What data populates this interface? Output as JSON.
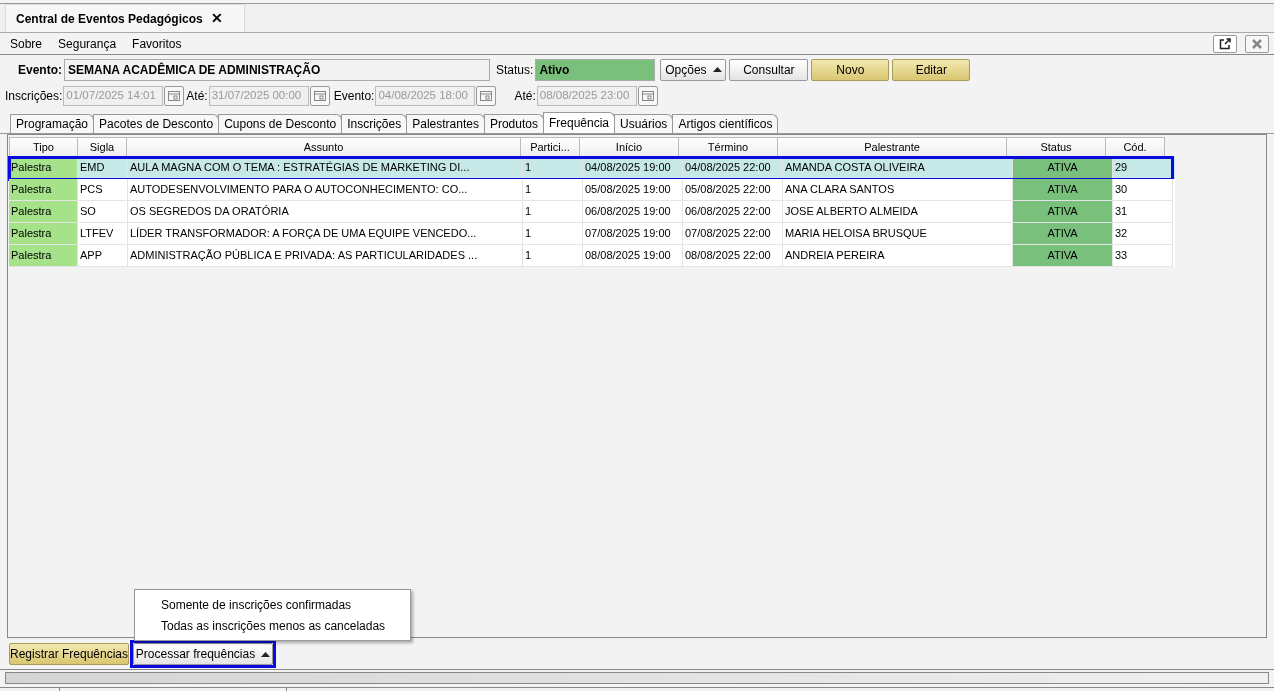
{
  "window_tab": {
    "title": "Central de Eventos Pedagógicos",
    "close": "✕"
  },
  "menu": [
    "Sobre",
    "Segurança",
    "Favoritos"
  ],
  "evento": {
    "label": "Evento:",
    "value": "SEMANA ACADÊMICA DE ADMINISTRAÇÃO"
  },
  "status": {
    "label": "Status:",
    "value": "Ativo"
  },
  "buttons": [
    {
      "label": "Opções",
      "kind": "dropdown"
    },
    {
      "label": "Consultar",
      "kind": "plain"
    },
    {
      "label": "Novo",
      "kind": "primary"
    },
    {
      "label": "Editar",
      "kind": "primary"
    }
  ],
  "dates": [
    {
      "label": "Inscrições:",
      "value": "01/07/2025 14:01",
      "disabled": true
    },
    {
      "label": "Até:",
      "value": "31/07/2025 00:00",
      "disabled": true
    },
    {
      "label": "Evento:",
      "value": "04/08/2025 18:00",
      "disabled": true
    },
    {
      "label": "Até:",
      "value": "08/08/2025 23:00",
      "disabled": true
    }
  ],
  "tabs": [
    {
      "label": "Programação",
      "selected": false
    },
    {
      "label": "Pacotes de Desconto",
      "selected": false
    },
    {
      "label": "Cupons de Desconto",
      "selected": false
    },
    {
      "label": "Inscrições",
      "selected": false
    },
    {
      "label": "Palestrantes",
      "selected": false
    },
    {
      "label": "Produtos",
      "selected": false
    },
    {
      "label": "Frequência",
      "selected": true
    },
    {
      "label": "Usuários",
      "selected": false
    },
    {
      "label": "Artigos científicos",
      "selected": false
    }
  ],
  "table": {
    "columns": [
      "Tipo",
      "Sigla",
      "Assunto",
      "Partici...",
      "Início",
      "Término",
      "Palestrante",
      "Status",
      "Cód."
    ],
    "rows": [
      {
        "selected": true,
        "highlighted": true,
        "cells": [
          "Palestra",
          "EMD",
          "AULA MAGNA COM O TEMA : ESTRATÉGIAS DE MARKETING DI...",
          "1",
          "04/08/2025 19:00",
          "04/08/2025 22:00",
          "AMANDA COSTA OLIVEIRA",
          "ATIVA",
          "29"
        ]
      },
      {
        "selected": false,
        "highlighted": false,
        "cells": [
          "Palestra",
          "PCS",
          "AUTODESENVOLVIMENTO PARA O AUTOCONHECIMENTO: CO...",
          "1",
          "05/08/2025 19:00",
          "05/08/2025 22:00",
          "ANA CLARA SANTOS",
          "ATIVA",
          "30"
        ]
      },
      {
        "selected": false,
        "highlighted": false,
        "cells": [
          "Palestra",
          "SO",
          "OS SEGREDOS DA ORATÓRIA",
          "1",
          "06/08/2025 19:00",
          "06/08/2025 22:00",
          "JOSE ALBERTO ALMEIDA",
          "ATIVA",
          "31"
        ]
      },
      {
        "selected": false,
        "highlighted": false,
        "cells": [
          "Palestra",
          "LTFEV",
          "LÍDER TRANSFORMADOR: A FORÇA DE UMA EQUIPE VENCEDO...",
          "1",
          "07/08/2025 19:00",
          "07/08/2025 22:00",
          "MARIA HELOISA BRUSQUE",
          "ATIVA",
          "32"
        ]
      },
      {
        "selected": false,
        "highlighted": false,
        "cells": [
          "Palestra",
          "APP",
          "ADMINISTRAÇÃO PÚBLICA E PRIVADA: AS PARTICULARIDADES ...",
          "1",
          "08/08/2025 19:00",
          "08/08/2025 22:00",
          "ANDREIA PEREIRA",
          "ATIVA",
          "33"
        ]
      }
    ]
  },
  "popup_menu": [
    "Somente de inscrições confirmadas",
    "Todas as inscrições menos as canceladas"
  ],
  "bottom_buttons": [
    {
      "label": "Registrar Frequências",
      "kind": "primary",
      "highlighted": false
    },
    {
      "label": "Processar frequências",
      "kind": "dropdown",
      "highlighted": true
    }
  ]
}
